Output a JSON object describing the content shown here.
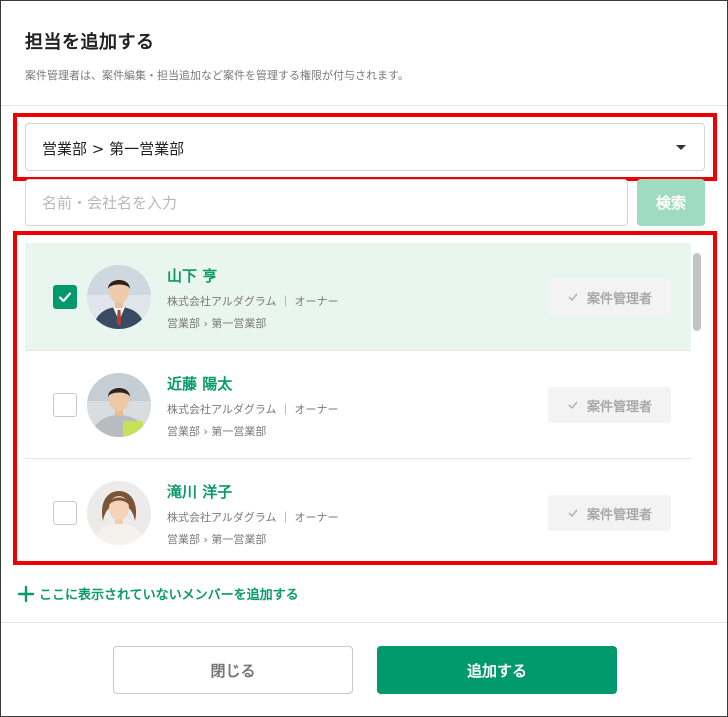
{
  "dialog": {
    "title": "担当を追加する",
    "description": "案件管理者は、案件編集・担当追加など案件を管理する権限が付与されます。"
  },
  "department_select": {
    "value": "営業部 > 第一営業部"
  },
  "search": {
    "placeholder": "名前・会社名を入力",
    "button_label": "検索"
  },
  "members": [
    {
      "name": "山下 亨",
      "company": "株式会社アルダグラム ｜ オーナー",
      "department": "営業部 › 第一営業部",
      "checked": true,
      "role_label": "案件管理者"
    },
    {
      "name": "近藤 陽太",
      "company": "株式会社アルダグラム ｜ オーナー",
      "department": "営業部 › 第一営業部",
      "checked": false,
      "role_label": "案件管理者"
    },
    {
      "name": "滝川 洋子",
      "company": "株式会社アルダグラム ｜ オーナー",
      "department": "営業部 › 第一営業部",
      "checked": false,
      "role_label": "案件管理者"
    }
  ],
  "add_member_link": "ここに表示されていないメンバーを追加する",
  "footer": {
    "close_label": "閉じる",
    "add_label": "追加する"
  },
  "colors": {
    "accent": "#00996b",
    "highlight": "#ee0000",
    "selected_row": "#e9f6f0"
  }
}
